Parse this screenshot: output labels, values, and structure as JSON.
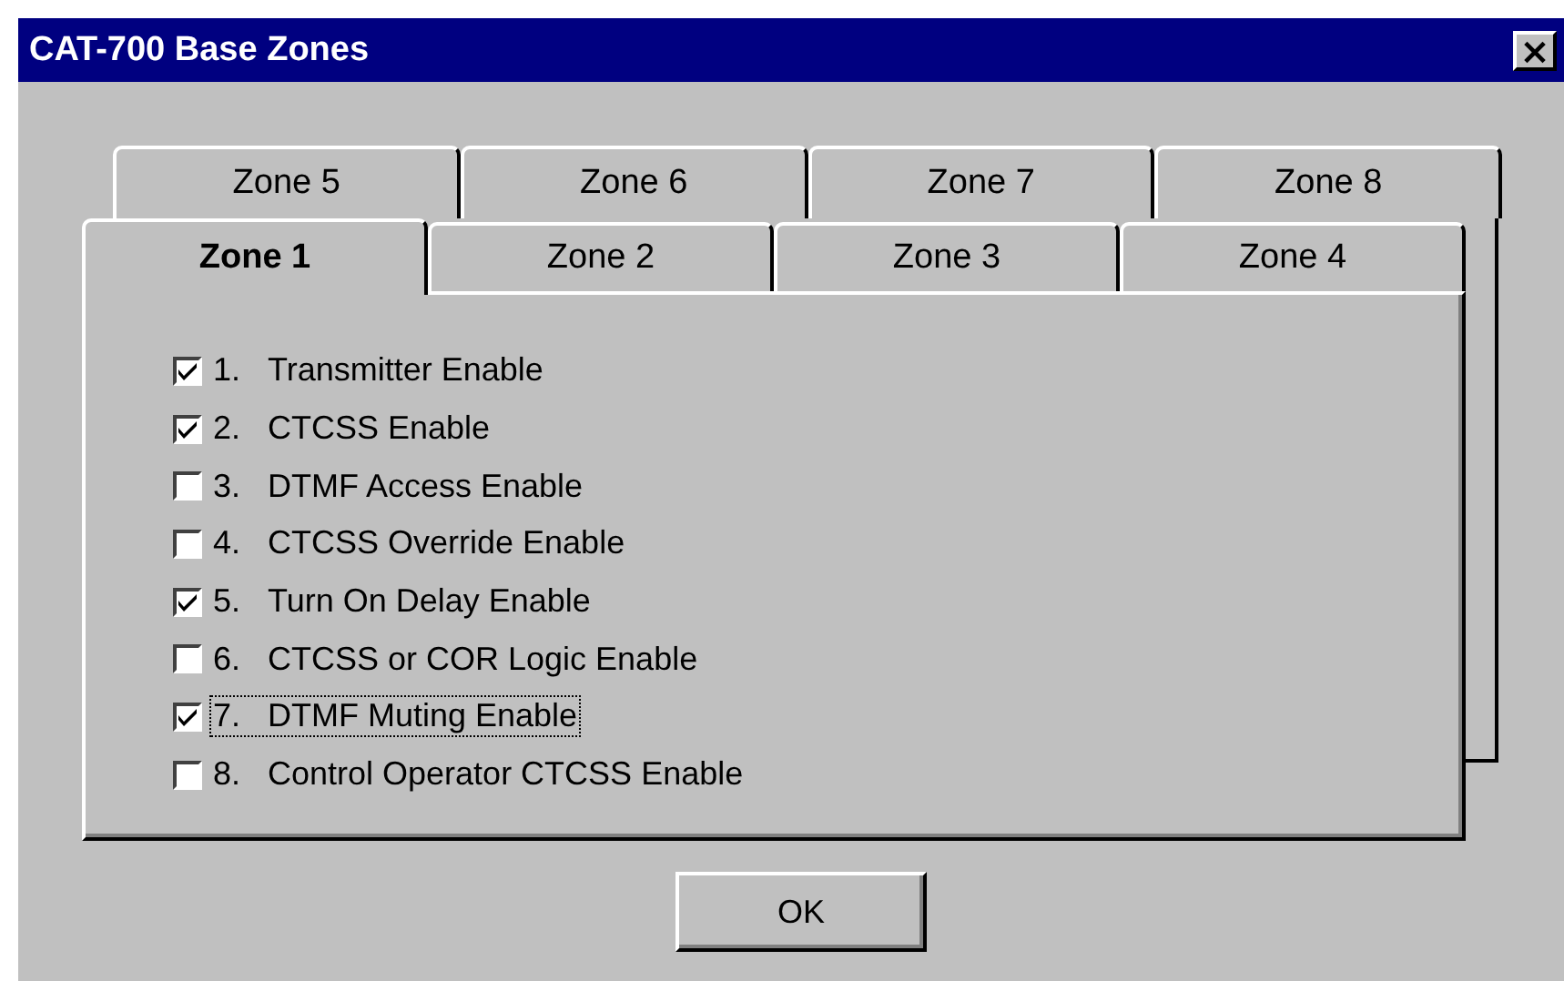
{
  "window": {
    "title": "CAT-700 Base Zones",
    "close": "×"
  },
  "tab_rows": [
    [
      {
        "label": "Zone 5",
        "selected": false
      },
      {
        "label": "Zone 6",
        "selected": false
      },
      {
        "label": "Zone 7",
        "selected": false
      },
      {
        "label": "Zone 8",
        "selected": false
      }
    ],
    [
      {
        "label": "Zone 1",
        "selected": true
      },
      {
        "label": "Zone 2",
        "selected": false
      },
      {
        "label": "Zone 3",
        "selected": false
      },
      {
        "label": "Zone 4",
        "selected": false
      }
    ]
  ],
  "options": [
    {
      "number": "1.",
      "label": "Transmitter Enable",
      "checked": true,
      "focused": false
    },
    {
      "number": "2.",
      "label": "CTCSS Enable",
      "checked": true,
      "focused": false
    },
    {
      "number": "3.",
      "label": "DTMF Access Enable",
      "checked": false,
      "focused": false
    },
    {
      "number": "4.",
      "label": "CTCSS Override Enable",
      "checked": false,
      "focused": false
    },
    {
      "number": "5.",
      "label": "Turn On Delay Enable",
      "checked": true,
      "focused": false
    },
    {
      "number": "6.",
      "label": "CTCSS or COR Logic Enable",
      "checked": false,
      "focused": false
    },
    {
      "number": "7.",
      "label": "DTMF Muting Enable",
      "checked": true,
      "focused": true
    },
    {
      "number": "8.",
      "label": "Control Operator CTCSS Enable",
      "checked": false,
      "focused": false
    }
  ],
  "buttons": [
    "OK"
  ]
}
